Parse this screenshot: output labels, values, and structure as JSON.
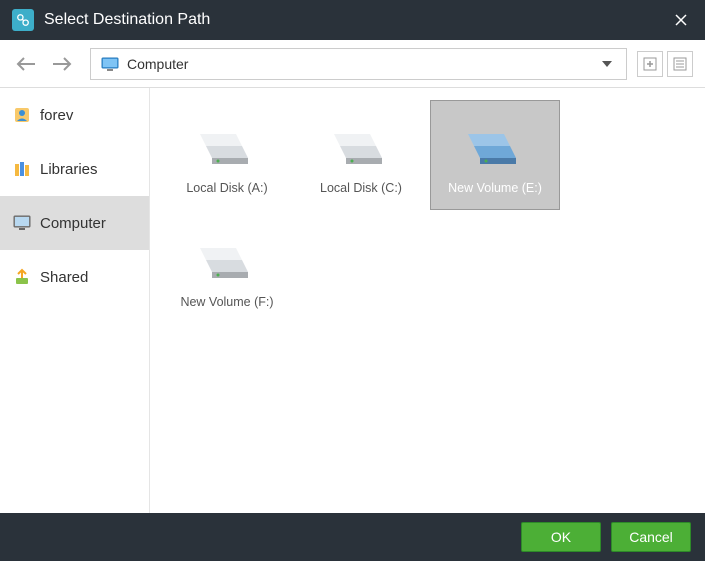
{
  "titlebar": {
    "title": "Select Destination Path"
  },
  "toolbar": {
    "path": {
      "text": "Computer"
    }
  },
  "sidebar": {
    "items": [
      {
        "label": "forev"
      },
      {
        "label": "Libraries"
      },
      {
        "label": "Computer"
      },
      {
        "label": "Shared"
      }
    ]
  },
  "drives": [
    {
      "label": "Local Disk (A:)",
      "selected": false,
      "color": "gray"
    },
    {
      "label": "Local Disk (C:)",
      "selected": false,
      "color": "gray"
    },
    {
      "label": "New Volume (E:)",
      "selected": true,
      "color": "blue"
    },
    {
      "label": "New Volume (F:)",
      "selected": false,
      "color": "gray"
    }
  ],
  "footer": {
    "ok_label": "OK",
    "cancel_label": "Cancel"
  }
}
